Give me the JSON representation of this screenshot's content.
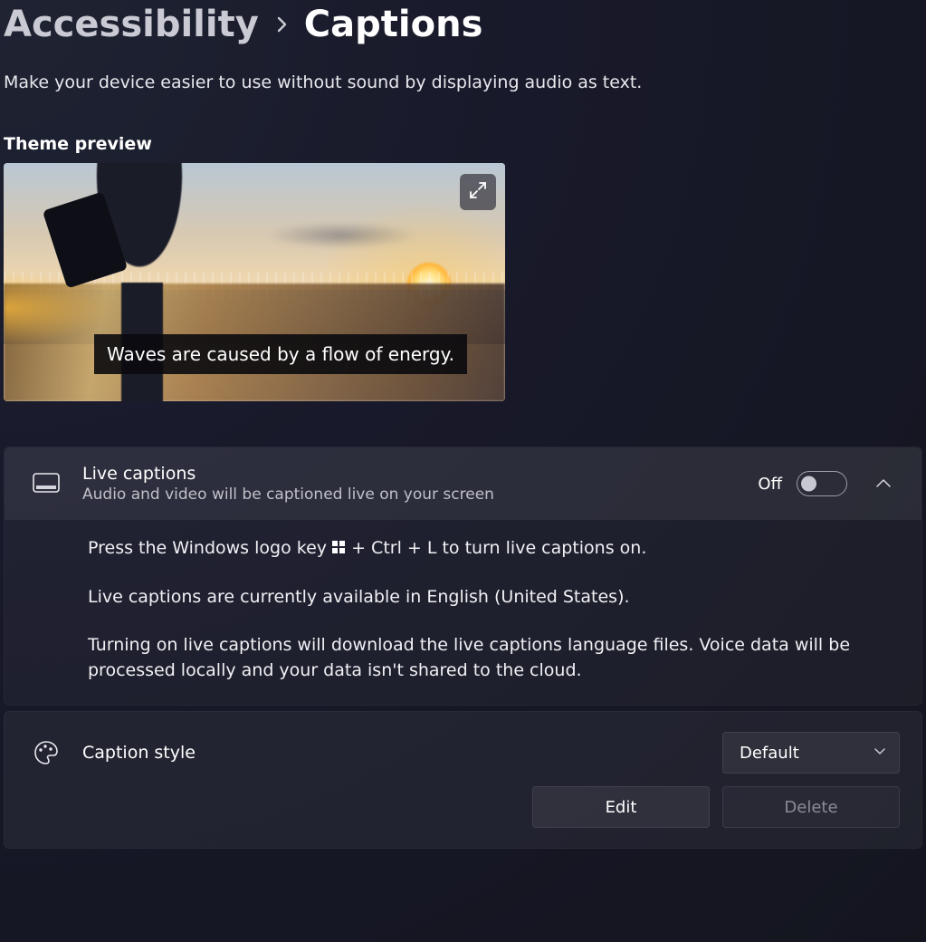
{
  "breadcrumb": {
    "parent": "Accessibility",
    "current": "Captions"
  },
  "description": "Make your device easier to use without sound by displaying audio as text.",
  "preview": {
    "section_label": "Theme preview",
    "caption_sample": "Waves are caused by a flow of energy.",
    "expand_icon": "expand-icon"
  },
  "live_captions": {
    "icon": "captions-icon",
    "title": "Live captions",
    "subtitle": "Audio and video will be captioned live on your screen",
    "toggle_state_label": "Off",
    "toggle_on": false,
    "expanded": true,
    "shortcut_prefix": "Press the Windows logo key ",
    "shortcut_suffix": " + Ctrl + L to turn live captions on.",
    "availability": "Live captions are currently available in English (United States).",
    "download_notice": "Turning on live captions will download the live captions language files. Voice data will be processed locally and your data isn't shared to the cloud."
  },
  "caption_style": {
    "icon": "palette-icon",
    "title": "Caption style",
    "selected_value": "Default",
    "edit_label": "Edit",
    "delete_label": "Delete",
    "delete_enabled": false
  }
}
